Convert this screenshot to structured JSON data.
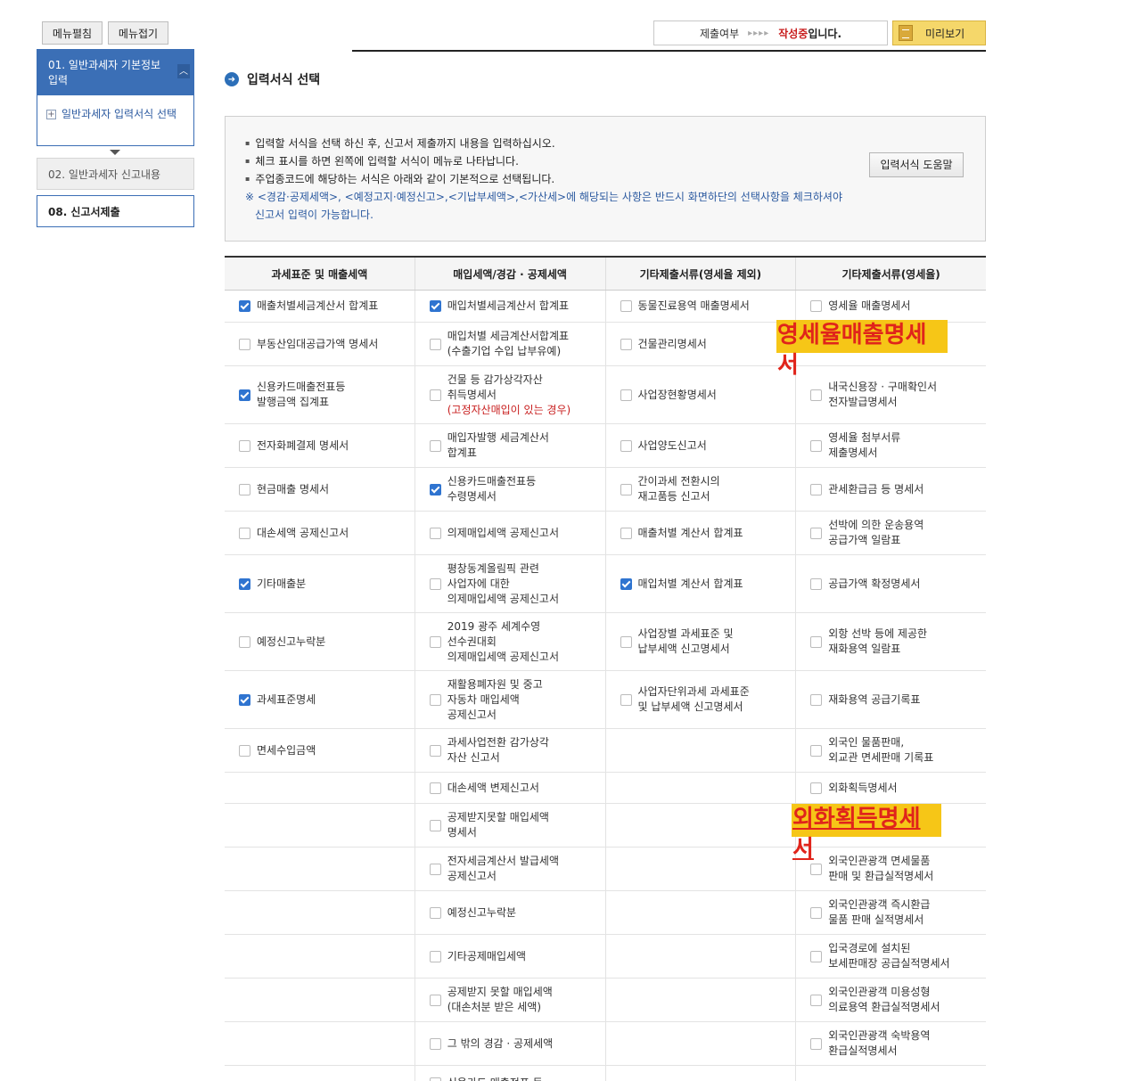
{
  "sidebar": {
    "menu_open": "메뉴펼침",
    "menu_close": "메뉴접기",
    "step1_title": "01. 일반과세자 기본정보 입력",
    "step1_sub": "일반과세자 입력서식 선택",
    "step2": "02. 일반과세자 신고내용",
    "step8": "08. 신고서제출"
  },
  "status": {
    "label": "제출여부",
    "arrows": "▸▸▸▸",
    "state_red": "작성중",
    "state_suffix": "입니다.",
    "preview": "미리보기"
  },
  "section_title": "입력서식 선택",
  "info": {
    "line1": "입력할 서식을 선택 하신 후, 신고서 제출까지 내용을 입력하십시오.",
    "line2": "체크 표시를 하면 왼쪽에 입력할 서식이 메뉴로 나타납니다.",
    "line3": "주업종코드에 해당하는 서식은 아래와 같이 기본적으로 선택됩니다.",
    "note1": "※ <경감·공제세액>, <예정고지·예정신고>,<기납부세액>,<가산세>에 해당되는 사항은 반드시  화면하단의 선택사항을 체크하셔야",
    "note2": "신고서 입력이 가능합니다.",
    "help_button": "입력서식 도움말"
  },
  "table": {
    "headers": [
      "과세표준 및 매출세액",
      "매입세액/경감 · 공제세액",
      "기타제출서류(영세율 제외)",
      "기타제출서류(영세율)"
    ],
    "rows": [
      {
        "h": 36,
        "c": [
          {
            "t": "매출처별세금계산서 합계표",
            "on": true
          },
          {
            "t": "매입처별세금계산서 합계표",
            "on": true
          },
          {
            "t": "동물진료용역 매출명세서",
            "on": false
          },
          {
            "t": "영세율 매출명세서",
            "on": false
          }
        ]
      },
      {
        "h": 49,
        "c": [
          {
            "t": "부동산임대공급가액 명세서",
            "on": false
          },
          {
            "t": "매입처별 세금계산서합계표\n(수출기업 수입 납부유예)",
            "on": false
          },
          {
            "t": "건물관리명세서",
            "on": false
          },
          null
        ]
      },
      {
        "h": 65,
        "c": [
          {
            "t": "신용카드매출전표등\n발행금액 집계표",
            "on": true
          },
          {
            "t": "건물 등 감가상각자산\n취득명세서",
            "on": false,
            "red": "(고정자산매입이 있는 경우)"
          },
          {
            "t": "사업장현황명세서",
            "on": false
          },
          {
            "t": "내국신용장 · 구매확인서\n전자발급명세서",
            "on": false
          }
        ]
      },
      {
        "h": 49,
        "c": [
          {
            "t": "전자화폐결제 명세서",
            "on": false
          },
          {
            "t": "매입자발행 세금계산서\n합계표",
            "on": false
          },
          {
            "t": "사업양도신고서",
            "on": false
          },
          {
            "t": "영세율 첨부서류\n제출명세서",
            "on": false
          }
        ]
      },
      {
        "h": 49,
        "c": [
          {
            "t": "현금매출 명세서",
            "on": false
          },
          {
            "t": "신용카드매출전표등\n수령명세서",
            "on": true
          },
          {
            "t": "간이과세 전환시의\n재고품등 신고서",
            "on": false
          },
          {
            "t": "관세환급금 등 명세서",
            "on": false
          }
        ]
      },
      {
        "h": 49,
        "c": [
          {
            "t": "대손세액 공제신고서",
            "on": false
          },
          {
            "t": "의제매입세액 공제신고서",
            "on": false
          },
          {
            "t": "매출처별 계산서 합계표",
            "on": false
          },
          {
            "t": "선박에 의한 운송용역\n공급가액 일람표",
            "on": false
          }
        ]
      },
      {
        "h": 65,
        "c": [
          {
            "t": "기타매출분",
            "on": true
          },
          {
            "t": "평창동계올림픽 관련\n사업자에 대한\n의제매입세액 공제신고서",
            "on": false
          },
          {
            "t": "매입처별 계산서 합계표",
            "on": true
          },
          {
            "t": "공급가액 확정명세서",
            "on": false
          }
        ]
      },
      {
        "h": 65,
        "c": [
          {
            "t": "예정신고누락분",
            "on": false
          },
          {
            "t": "2019 광주 세계수영\n선수권대회\n의제매입세액 공제신고서",
            "on": false
          },
          {
            "t": "사업장별 과세표준 및\n납부세액 신고명세서",
            "on": false
          },
          {
            "t": "외항 선박 등에 제공한\n재화용역 일람표",
            "on": false
          }
        ]
      },
      {
        "h": 65,
        "c": [
          {
            "t": "과세표준명세",
            "on": true
          },
          {
            "t": "재활용폐자원 및 중고\n자동차 매입세액\n공제신고서",
            "on": false
          },
          {
            "t": "사업자단위과세 과세표준\n및 납부세액 신고명세서",
            "on": false
          },
          {
            "t": "재화용역 공급기록표",
            "on": false
          }
        ]
      },
      {
        "h": 49,
        "c": [
          {
            "t": "면세수입금액",
            "on": false
          },
          {
            "t": "과세사업전환 감가상각\n자산 신고서",
            "on": false
          },
          null,
          {
            "t": "외국인 물품판매,\n외교관 면세판매 기록표",
            "on": false
          }
        ]
      },
      {
        "h": 35,
        "c": [
          null,
          {
            "t": "대손세액 변제신고서",
            "on": false
          },
          null,
          {
            "t": "외화획득명세서",
            "on": false
          }
        ]
      },
      {
        "h": 49,
        "c": [
          null,
          {
            "t": "공제받지못할 매입세액\n명세서",
            "on": false
          },
          null,
          null
        ]
      },
      {
        "h": 49,
        "c": [
          null,
          {
            "t": "전자세금계산서 발급세액\n공제신고서",
            "on": false
          },
          null,
          {
            "t": "외국인관광객 면세물품\n판매 및 환급실적명세서",
            "on": false
          }
        ]
      },
      {
        "h": 49,
        "c": [
          null,
          {
            "t": "예정신고누락분",
            "on": false
          },
          null,
          {
            "t": "외국인관광객 즉시환급\n물품 판매 실적명세서",
            "on": false
          }
        ]
      },
      {
        "h": 49,
        "c": [
          null,
          {
            "t": "기타공제매입세액",
            "on": false
          },
          null,
          {
            "t": "입국경로에 설치된\n보세판매장 공급실적명세서",
            "on": false
          }
        ]
      },
      {
        "h": 49,
        "c": [
          null,
          {
            "t": "공제받지 못할 매입세액\n(대손처분 받은 세액)",
            "on": false
          },
          null,
          {
            "t": "외국인관광객 미용성형\n의료용역 환급실적명세서",
            "on": false
          }
        ]
      },
      {
        "h": 49,
        "c": [
          null,
          {
            "t": "그 밖의 경감 · 공제세액",
            "on": false
          },
          null,
          {
            "t": "외국인관광객 숙박용역\n환급실적명세서",
            "on": false
          }
        ]
      },
      {
        "h": 40,
        "c": [
          null,
          {
            "t": "신용카드 매출전표 등",
            "on": false
          },
          null,
          null
        ]
      }
    ]
  },
  "highlights": {
    "h1": "영세율매출명세서",
    "h2": "외화획득명세서"
  }
}
